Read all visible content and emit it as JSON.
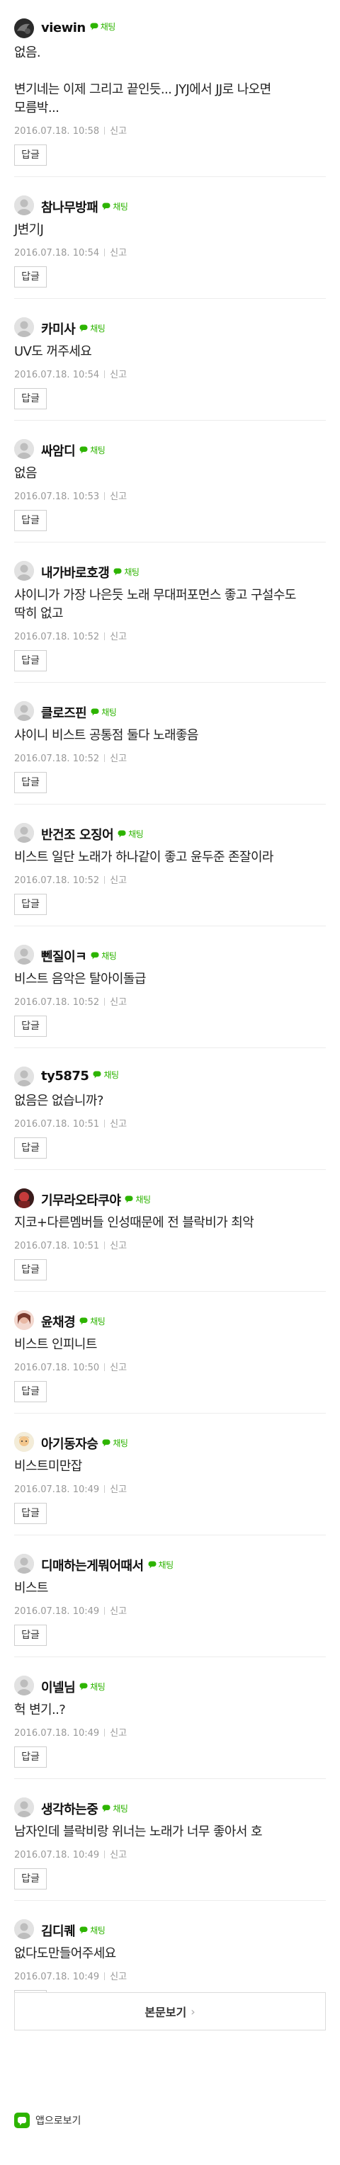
{
  "chat_badge_label": "채팅",
  "reply_label": "답글",
  "report_label": "신고",
  "comments": [
    {
      "nick": "viewin",
      "avatar": "dark",
      "lines": [
        "없음.",
        "",
        "변기네는 이제 그리고 끝인듯... JYJ에서 JJ로 나오면",
        "모름박..."
      ],
      "time": "2016.07.18. 10:58"
    },
    {
      "nick": "참나무방패",
      "avatar": "default",
      "lines": [
        "J변기J"
      ],
      "time": "2016.07.18. 10:54"
    },
    {
      "nick": "카미사",
      "avatar": "default",
      "lines": [
        "UV도 꺼주세요"
      ],
      "time": "2016.07.18. 10:54"
    },
    {
      "nick": "싸암디",
      "avatar": "default",
      "lines": [
        "없음"
      ],
      "time": "2016.07.18. 10:53"
    },
    {
      "nick": "내가바로호갱",
      "avatar": "default",
      "lines": [
        "샤이니가 가장 나은듯 노래 무대퍼포먼스 좋고 구설수도",
        "딱히 없고"
      ],
      "time": "2016.07.18. 10:52"
    },
    {
      "nick": "클로즈핀",
      "avatar": "default",
      "lines": [
        "샤이니 비스트 공통점 둘다 노래좋음"
      ],
      "time": "2016.07.18. 10:52"
    },
    {
      "nick": "반건조 오징어",
      "avatar": "default",
      "lines": [
        "비스트 일단 노래가 하나같이 좋고 윤두준 존잘이라"
      ],
      "time": "2016.07.18. 10:52"
    },
    {
      "nick": "뻰질이ㅋ",
      "avatar": "default",
      "lines": [
        "비스트 음악은 탈아이돌급"
      ],
      "time": "2016.07.18. 10:52"
    },
    {
      "nick": "ty5875",
      "avatar": "default",
      "lines": [
        "없음은 없습니까?"
      ],
      "time": "2016.07.18. 10:51"
    },
    {
      "nick": "기무라오타쿠야",
      "avatar": "red",
      "lines": [
        "지코+다른멤버들 인성때문에 전 블락비가 최악"
      ],
      "time": "2016.07.18. 10:51"
    },
    {
      "nick": "윤채경",
      "avatar": "pink",
      "lines": [
        "비스트 인피니트"
      ],
      "time": "2016.07.18. 10:50"
    },
    {
      "nick": "아기동자승",
      "avatar": "cartoon",
      "lines": [
        "비스트미만잡"
      ],
      "time": "2016.07.18. 10:49"
    },
    {
      "nick": "디매하는게뭐어때서",
      "avatar": "default",
      "lines": [
        "비스트"
      ],
      "time": "2016.07.18. 10:49"
    },
    {
      "nick": "이넬님",
      "avatar": "default",
      "lines": [
        "헉 변기..?"
      ],
      "time": "2016.07.18. 10:49"
    },
    {
      "nick": "생각하는중",
      "avatar": "default",
      "lines": [
        "남자인데 블락비랑 위너는 노래가 너무 좋아서 호"
      ],
      "time": "2016.07.18. 10:49"
    },
    {
      "nick": "김디퀘",
      "avatar": "default",
      "lines": [
        "없다도만들어주세요"
      ],
      "time": "2016.07.18. 10:49"
    }
  ],
  "more_button": {
    "label": "본문보기"
  },
  "app_link": {
    "label": "앱으로보기"
  },
  "colors": {
    "accent": "#2db400",
    "meta": "#999999",
    "border": "#ececec"
  }
}
